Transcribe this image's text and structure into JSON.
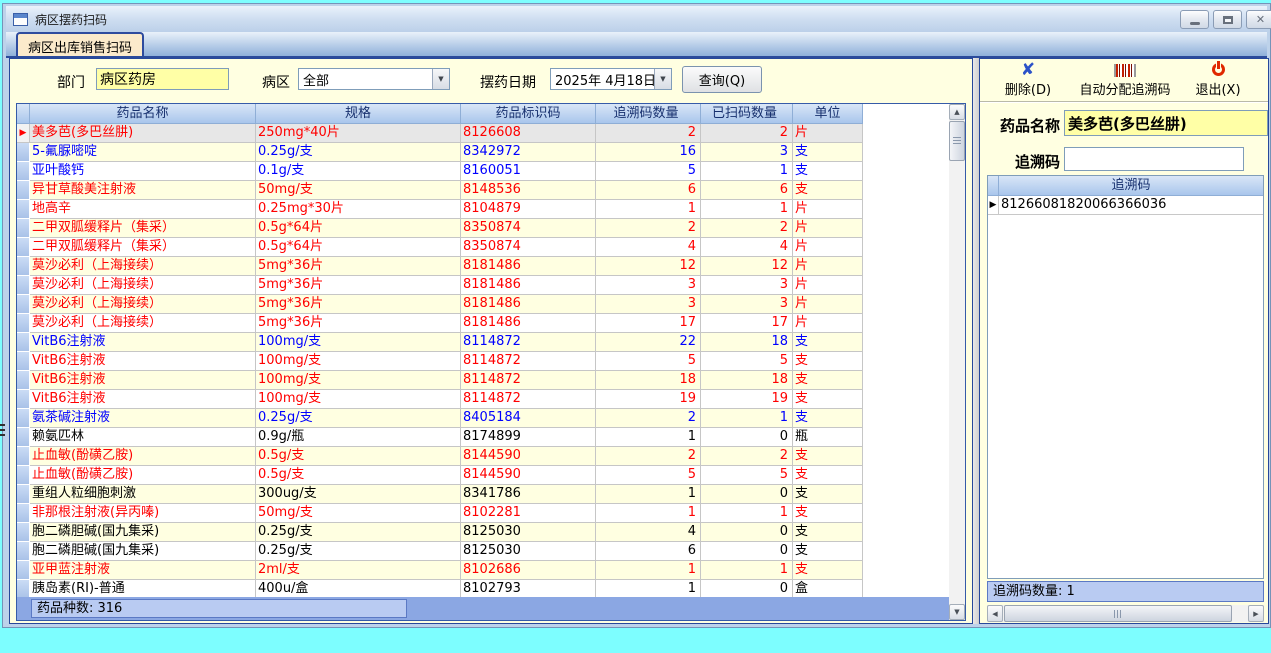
{
  "window": {
    "title": "病区摆药扫码"
  },
  "tab_label": "病区出库销售扫码",
  "filters": {
    "dept_label": "部门",
    "dept_value": "病区药房",
    "ward_label": "病区",
    "ward_value": "全部",
    "date_label": "摆药日期",
    "date_value": "2025年 4月18日",
    "query_button_label": "查询(Q)"
  },
  "table": {
    "headers": [
      "药品名称",
      "规格",
      "药品标识码",
      "追溯码数量",
      "已扫码数量",
      "单位"
    ],
    "footer_text": "药品种数: 316",
    "rows": [
      {
        "name": "美多芭(多巴丝肼)",
        "spec": "250mg*40片",
        "code": "8126608",
        "trace_qty": "2",
        "scanned_qty": "2",
        "unit": "片",
        "state": "complete",
        "selected": true
      },
      {
        "name": "5-氟脲嘧啶",
        "spec": "0.25g/支",
        "code": "8342972",
        "trace_qty": "16",
        "scanned_qty": "3",
        "unit": "支",
        "state": "partial"
      },
      {
        "name": "亚叶酸钙",
        "spec": "0.1g/支",
        "code": "8160051",
        "trace_qty": "5",
        "scanned_qty": "1",
        "unit": "支",
        "state": "partial"
      },
      {
        "name": "异甘草酸美注射液",
        "spec": "50mg/支",
        "code": "8148536",
        "trace_qty": "6",
        "scanned_qty": "6",
        "unit": "支",
        "state": "complete"
      },
      {
        "name": "地高辛",
        "spec": "0.25mg*30片",
        "code": "8104879",
        "trace_qty": "1",
        "scanned_qty": "1",
        "unit": "片",
        "state": "complete"
      },
      {
        "name": "二甲双胍缓释片（集采）",
        "spec": "0.5g*64片",
        "code": "8350874",
        "trace_qty": "2",
        "scanned_qty": "2",
        "unit": "片",
        "state": "complete"
      },
      {
        "name": "二甲双胍缓释片（集采）",
        "spec": "0.5g*64片",
        "code": "8350874",
        "trace_qty": "4",
        "scanned_qty": "4",
        "unit": "片",
        "state": "complete"
      },
      {
        "name": "莫沙必利（上海接续）",
        "spec": "5mg*36片",
        "code": "8181486",
        "trace_qty": "12",
        "scanned_qty": "12",
        "unit": "片",
        "state": "complete"
      },
      {
        "name": "莫沙必利（上海接续）",
        "spec": "5mg*36片",
        "code": "8181486",
        "trace_qty": "3",
        "scanned_qty": "3",
        "unit": "片",
        "state": "complete"
      },
      {
        "name": "莫沙必利（上海接续）",
        "spec": "5mg*36片",
        "code": "8181486",
        "trace_qty": "3",
        "scanned_qty": "3",
        "unit": "片",
        "state": "complete"
      },
      {
        "name": "莫沙必利（上海接续）",
        "spec": "5mg*36片",
        "code": "8181486",
        "trace_qty": "17",
        "scanned_qty": "17",
        "unit": "片",
        "state": "complete"
      },
      {
        "name": "VitB6注射液",
        "spec": "100mg/支",
        "code": "8114872",
        "trace_qty": "22",
        "scanned_qty": "18",
        "unit": "支",
        "state": "partial"
      },
      {
        "name": "VitB6注射液",
        "spec": "100mg/支",
        "code": "8114872",
        "trace_qty": "5",
        "scanned_qty": "5",
        "unit": "支",
        "state": "complete"
      },
      {
        "name": "VitB6注射液",
        "spec": "100mg/支",
        "code": "8114872",
        "trace_qty": "18",
        "scanned_qty": "18",
        "unit": "支",
        "state": "complete"
      },
      {
        "name": "VitB6注射液",
        "spec": "100mg/支",
        "code": "8114872",
        "trace_qty": "19",
        "scanned_qty": "19",
        "unit": "支",
        "state": "complete"
      },
      {
        "name": "氨茶碱注射液",
        "spec": "0.25g/支",
        "code": "8405184",
        "trace_qty": "2",
        "scanned_qty": "1",
        "unit": "支",
        "state": "partial"
      },
      {
        "name": "赖氨匹林",
        "spec": "0.9g/瓶",
        "code": "8174899",
        "trace_qty": "1",
        "scanned_qty": "0",
        "unit": "瓶",
        "state": "none"
      },
      {
        "name": "止血敏(酚磺乙胺)",
        "spec": "0.5g/支",
        "code": "8144590",
        "trace_qty": "2",
        "scanned_qty": "2",
        "unit": "支",
        "state": "complete"
      },
      {
        "name": "止血敏(酚磺乙胺)",
        "spec": "0.5g/支",
        "code": "8144590",
        "trace_qty": "5",
        "scanned_qty": "5",
        "unit": "支",
        "state": "complete"
      },
      {
        "name": "重组人粒细胞刺激",
        "spec": "300ug/支",
        "code": "8341786",
        "trace_qty": "1",
        "scanned_qty": "0",
        "unit": "支",
        "state": "none"
      },
      {
        "name": "非那根注射液(异丙嗪)",
        "spec": "50mg/支",
        "code": "8102281",
        "trace_qty": "1",
        "scanned_qty": "1",
        "unit": "支",
        "state": "complete"
      },
      {
        "name": "胞二磷胆碱(国九集采)",
        "spec": "0.25g/支",
        "code": "8125030",
        "trace_qty": "4",
        "scanned_qty": "0",
        "unit": "支",
        "state": "none"
      },
      {
        "name": "胞二磷胆碱(国九集采)",
        "spec": "0.25g/支",
        "code": "8125030",
        "trace_qty": "6",
        "scanned_qty": "0",
        "unit": "支",
        "state": "none"
      },
      {
        "name": "亚甲蓝注射液",
        "spec": "2ml/支",
        "code": "8102686",
        "trace_qty": "1",
        "scanned_qty": "1",
        "unit": "支",
        "state": "complete"
      },
      {
        "name": "胰岛素(RI)-普通",
        "spec": "400u/盒",
        "code": "8102793",
        "trace_qty": "1",
        "scanned_qty": "0",
        "unit": "盒",
        "state": "none"
      }
    ]
  },
  "right_panel": {
    "delete_button_label": "删除(D)",
    "auto_assign_button_label": "自动分配追溯码",
    "exit_button_label": "退出(X)",
    "drug_name_label": "药品名称",
    "drug_name_value": "美多芭(多巴丝肼)",
    "trace_code_label": "追溯码",
    "trace_code_value": "",
    "list_header": "追溯码",
    "trace_codes": [
      "81266081820066366036"
    ],
    "count_text": "追溯码数量: 1"
  },
  "colors": {
    "status_complete": "#FF0000",
    "status_partial": "#0000FF",
    "status_pending": "#000000",
    "row_cream": "#FFFFE1",
    "selected_row": "#E7E7E7",
    "header_blue": "#A9C6EC",
    "footer_blue": "#8BA7E3",
    "desktop_cyan": "#7DFEFF"
  }
}
